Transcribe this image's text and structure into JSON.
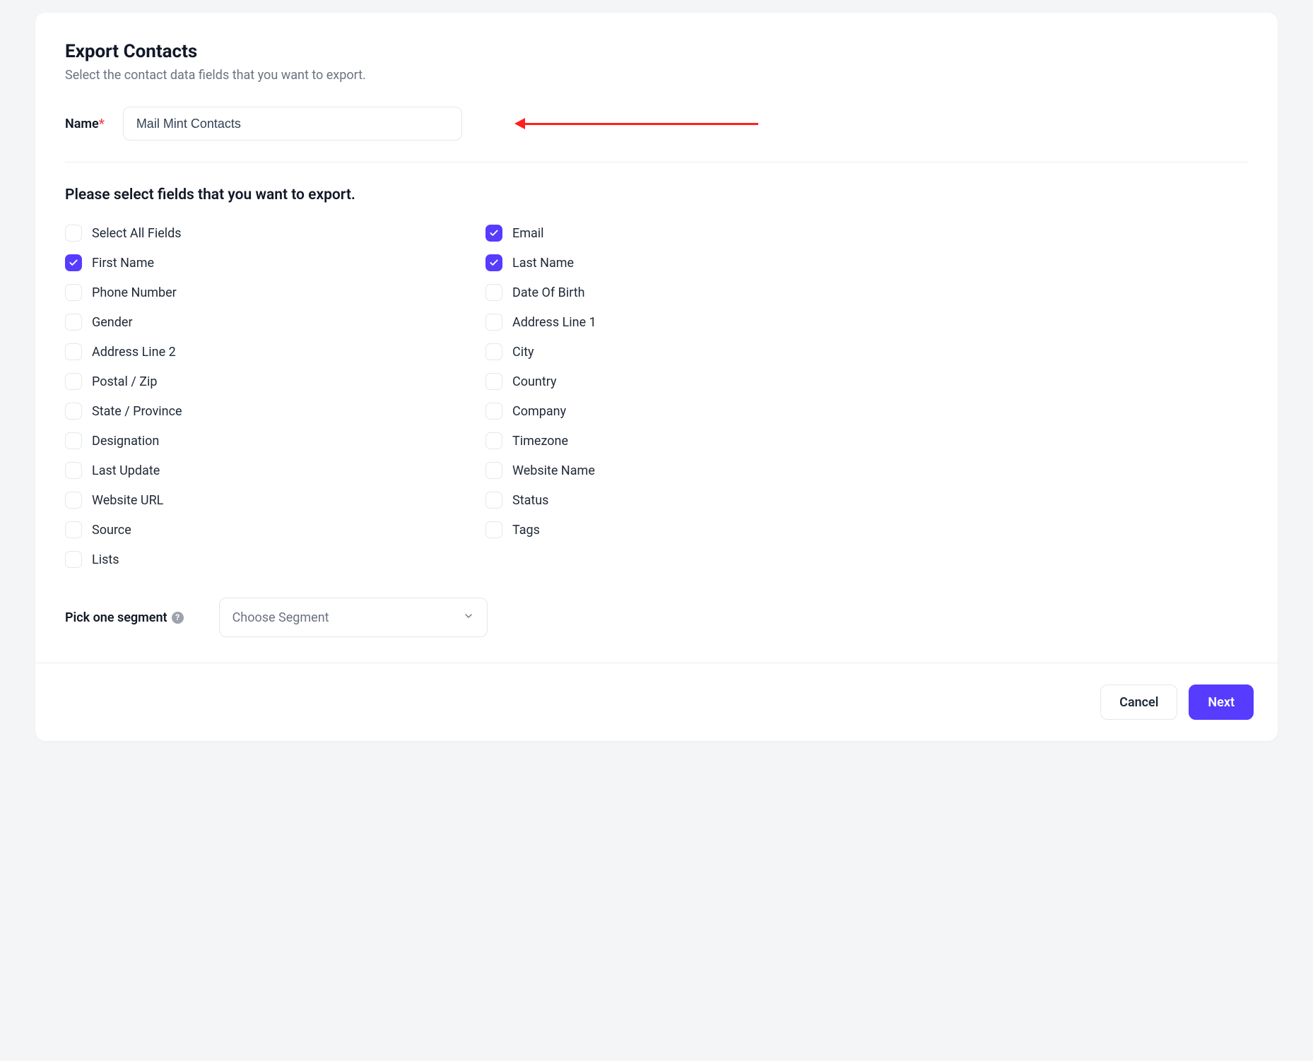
{
  "header": {
    "title": "Export Contacts",
    "subtitle": "Select the contact data fields that you want to export."
  },
  "name": {
    "label": "Name",
    "required_marker": "*",
    "value": "Mail Mint Contacts"
  },
  "fields_heading": "Please select fields that you want to export.",
  "fields": [
    {
      "label": "Select All Fields",
      "checked": false
    },
    {
      "label": "Email",
      "checked": true
    },
    {
      "label": "First Name",
      "checked": true
    },
    {
      "label": "Last Name",
      "checked": true
    },
    {
      "label": "Phone Number",
      "checked": false
    },
    {
      "label": "Date Of Birth",
      "checked": false
    },
    {
      "label": "Gender",
      "checked": false
    },
    {
      "label": "Address Line 1",
      "checked": false
    },
    {
      "label": "Address Line 2",
      "checked": false
    },
    {
      "label": "City",
      "checked": false
    },
    {
      "label": "Postal / Zip",
      "checked": false
    },
    {
      "label": "Country",
      "checked": false
    },
    {
      "label": "State / Province",
      "checked": false
    },
    {
      "label": "Company",
      "checked": false
    },
    {
      "label": "Designation",
      "checked": false
    },
    {
      "label": "Timezone",
      "checked": false
    },
    {
      "label": "Last Update",
      "checked": false
    },
    {
      "label": "Website Name",
      "checked": false
    },
    {
      "label": "Website URL",
      "checked": false
    },
    {
      "label": "Status",
      "checked": false
    },
    {
      "label": "Source",
      "checked": false
    },
    {
      "label": "Tags",
      "checked": false
    },
    {
      "label": "Lists",
      "checked": false
    }
  ],
  "segment": {
    "label": "Pick one segment",
    "help_marker": "?",
    "placeholder": "Choose Segment"
  },
  "footer": {
    "cancel": "Cancel",
    "next": "Next"
  },
  "colors": {
    "accent": "#573bff",
    "arrow": "#ff1f1f"
  }
}
